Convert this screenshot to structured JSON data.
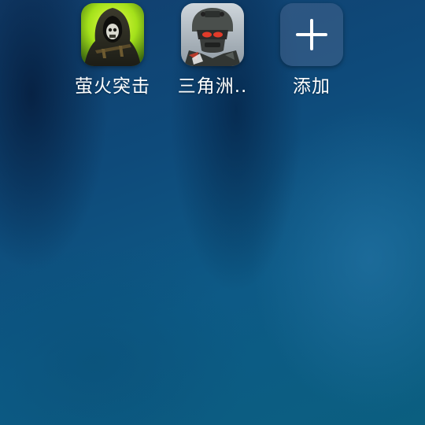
{
  "home_screen": {
    "apps": [
      {
        "label": "萤火突击",
        "icon": "firefly-assault-icon"
      },
      {
        "label": "三角洲..",
        "icon": "delta-force-icon"
      },
      {
        "label": "添加",
        "icon": "plus-icon"
      }
    ]
  },
  "colors": {
    "wallpaper_base": "#0b4a73",
    "label_text": "#ffffff",
    "app1_accent": "#b6f01a"
  }
}
